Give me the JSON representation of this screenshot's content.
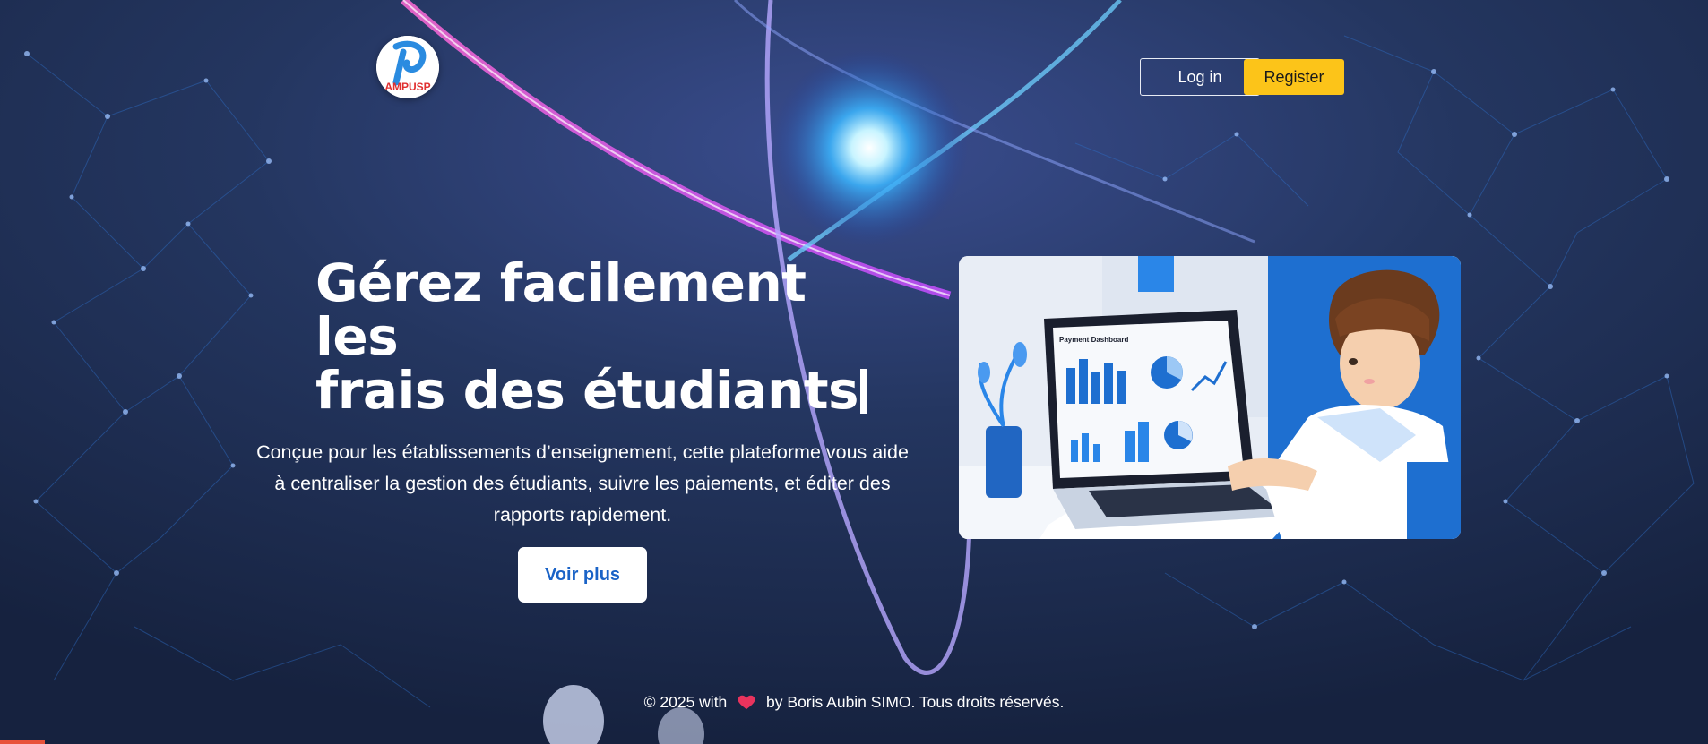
{
  "header": {
    "logo_text": "AMPUSP",
    "login_label": "Log in",
    "register_label": "Register"
  },
  "hero": {
    "title_line1": "Gérez facilement les",
    "title_line2": "frais des étudiants",
    "description": "Conçue pour les établissements d’enseignement, cette plateforme vous aide à centraliser la gestion des étudiants, suivre les paiements, et éditer des rapports rapidement.",
    "cta_label": "Voir plus"
  },
  "illustration": {
    "screen_title": "Payment Dashboard"
  },
  "footer": {
    "prefix": "© 2025 with",
    "heart_icon": "heart-icon",
    "suffix": "by Boris Aubin SIMO. Tous droits réservés."
  },
  "colors": {
    "background": "#1c2c4f",
    "register": "#fcc419",
    "cta_text": "#1a63c7",
    "heart": "#e8335d"
  }
}
